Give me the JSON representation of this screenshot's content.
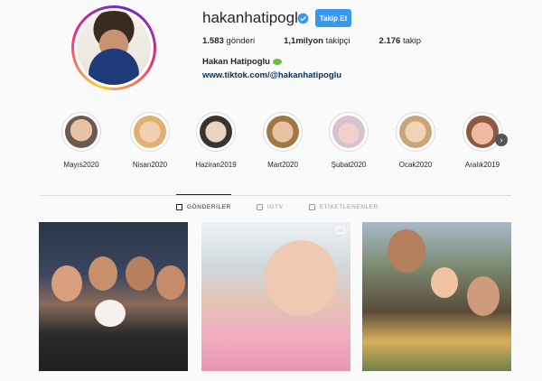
{
  "profile": {
    "username": "hakanhatipoglu",
    "follow_label": "Takip Et",
    "stats": [
      {
        "value": "1.583",
        "label": "gönderi"
      },
      {
        "value": "1,1milyon",
        "label": "takipçi"
      },
      {
        "value": "2.176",
        "label": "takip"
      }
    ],
    "full_name": "Hakan Hatipoglu",
    "bio_link": "www.tiktok.com/@hakanhatipoglu"
  },
  "highlights": [
    {
      "label": "Mayıs2020",
      "color": "#c9a28a"
    },
    {
      "label": "Nisan2020",
      "color": "#e6c19a"
    },
    {
      "label": "Haziran2019",
      "color": "#d7b9a2"
    },
    {
      "label": "Mart2020",
      "color": "#caa088"
    },
    {
      "label": "Şubat2020",
      "color": "#e0c9c4"
    },
    {
      "label": "Ocak2020",
      "color": "#e7c3a5"
    },
    {
      "label": "Aralık2019",
      "color": "#d6a38c"
    }
  ],
  "tabs": [
    {
      "label": "GÖNDERİLER",
      "icon": "grid-icon",
      "active": true
    },
    {
      "label": "IGTV",
      "icon": "igtv-icon",
      "active": false
    },
    {
      "label": "ETİKETLENENLER",
      "icon": "tagged-icon",
      "active": false
    }
  ],
  "colors": {
    "follow_button": "#3897f0",
    "verified_badge": "#3897f0",
    "link": "#003569"
  }
}
